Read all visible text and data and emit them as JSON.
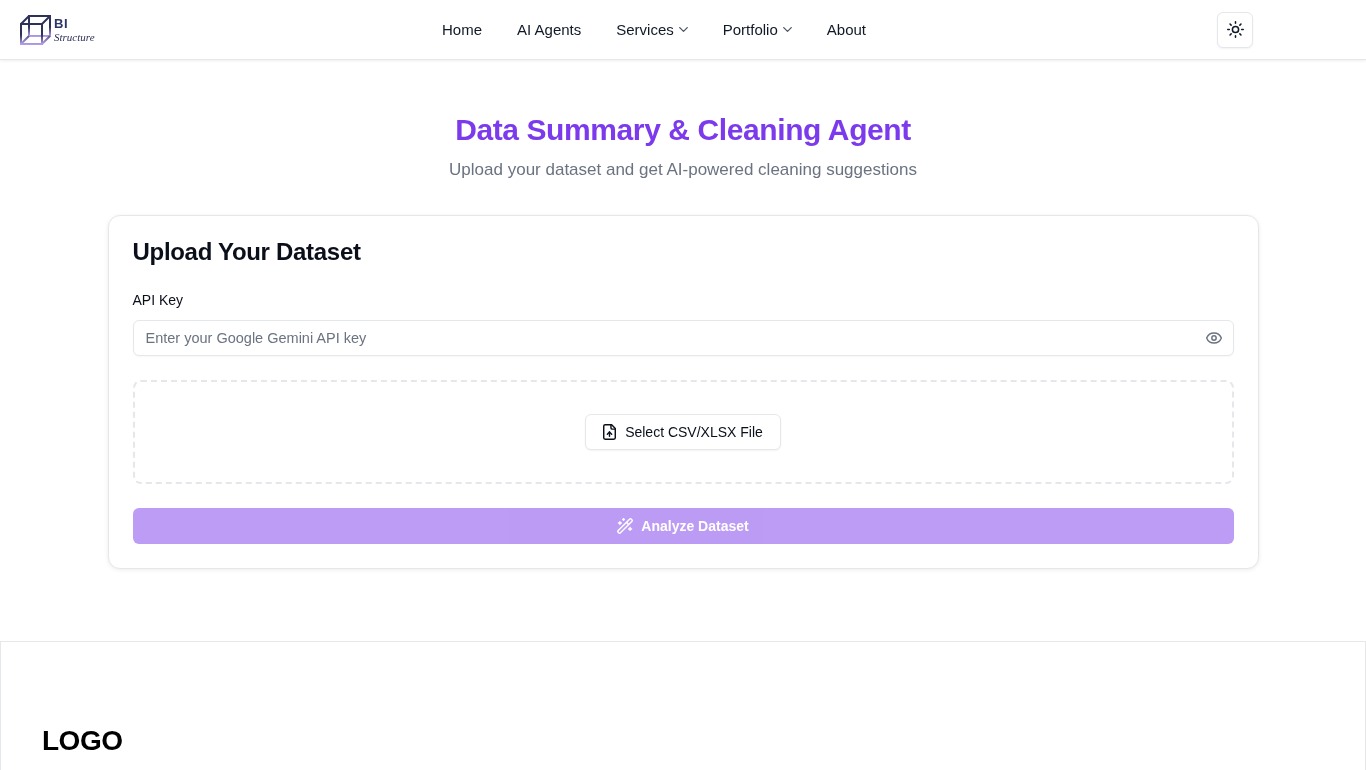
{
  "header": {
    "logo": {
      "line_1": "BI",
      "line_2": "Structure"
    },
    "nav": [
      {
        "label": "Home",
        "dropdown": false
      },
      {
        "label": "AI Agents",
        "dropdown": false
      },
      {
        "label": "Services",
        "dropdown": true
      },
      {
        "label": "Portfolio",
        "dropdown": true
      },
      {
        "label": "About",
        "dropdown": false
      }
    ]
  },
  "hero": {
    "title": "Data Summary & Cleaning Agent",
    "subtitle": "Upload your dataset and get AI-powered cleaning suggestions"
  },
  "upload_card": {
    "title": "Upload Your Dataset",
    "api_key": {
      "label": "API Key",
      "placeholder": "Enter your Google Gemini API key"
    },
    "file_button": "Select CSV/XLSX File",
    "analyze_button": {
      "label": "Analyze Dataset",
      "disabled": true
    }
  },
  "footer": {
    "logo": "LOGO"
  }
}
